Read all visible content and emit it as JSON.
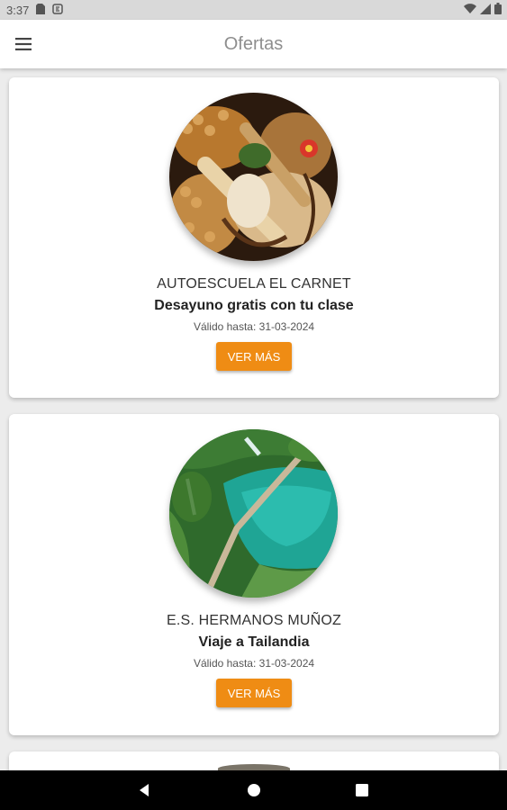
{
  "status_bar": {
    "time": "3:37",
    "icons": [
      "sim-card-icon",
      "app-notification-icon",
      "wifi-icon",
      "signal-icon",
      "battery-icon"
    ]
  },
  "app_bar": {
    "title": "Ofertas",
    "menu_icon": "hamburger-menu-icon"
  },
  "colors": {
    "accent": "#ef8c14",
    "title_gray": "#8e8e8e",
    "background": "#ececec"
  },
  "offers": [
    {
      "company": "AUTOESCUELA EL CARNET",
      "title": "Desayuno gratis con tu clase",
      "valid_until": "Válido hasta: 31-03-2024",
      "button_label": "VER MÁS",
      "image": "bread-basket-photo"
    },
    {
      "company": "E.S. HERMANOS MUÑOZ",
      "title": "Viaje a Tailandia",
      "valid_until": "Válido hasta: 31-03-2024",
      "button_label": "VER MÁS",
      "image": "lake-boardwalk-photo"
    }
  ],
  "nav_bar": {
    "buttons": [
      "back-icon",
      "home-icon",
      "recents-icon"
    ]
  }
}
